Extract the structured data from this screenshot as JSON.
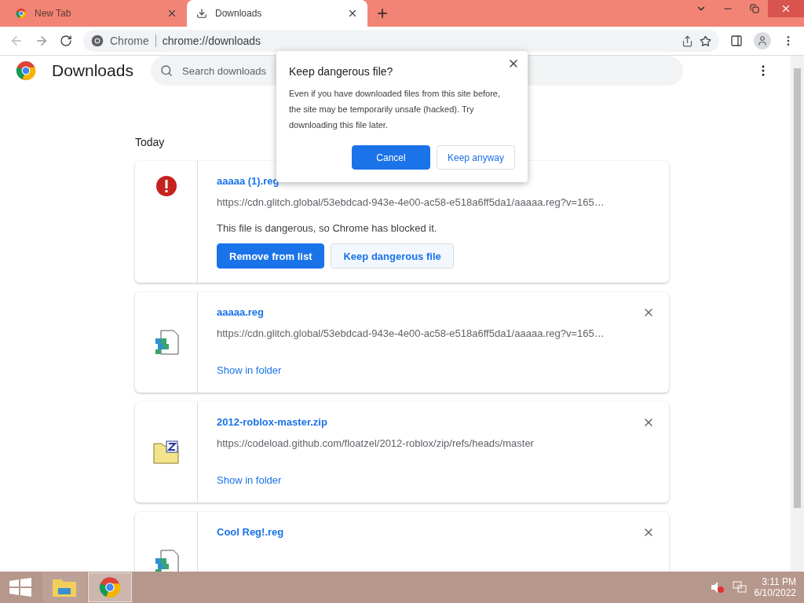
{
  "tabs": [
    {
      "title": "New Tab",
      "selected": false
    },
    {
      "title": "Downloads",
      "selected": true
    }
  ],
  "address": {
    "site_label": "Chrome",
    "url": "chrome://downloads"
  },
  "page": {
    "title": "Downloads",
    "search": {
      "placeholder": "Search downloads"
    },
    "section": "Today"
  },
  "downloads": [
    {
      "kind": "dangerous",
      "name": "aaaaa (1).reg",
      "url": "https://cdn.glitch.global/53ebdcad-943e-4e00-ac58-e518a6ff5da1/aaaaa.reg?v=165…",
      "warning": "This file is dangerous, so Chrome has blocked it.",
      "actions": [
        {
          "label": "Remove from list",
          "primary": true
        },
        {
          "label": "Keep dangerous file",
          "primary": false
        }
      ]
    },
    {
      "kind": "registry",
      "name": "aaaaa.reg",
      "url": "https://cdn.glitch.global/53ebdcad-943e-4e00-ac58-e518a6ff5da1/aaaaa.reg?v=165…",
      "link": "Show in folder"
    },
    {
      "kind": "zip",
      "name": "2012-roblox-master.zip",
      "url": "https://codeload.github.com/floatzel/2012-roblox/zip/refs/heads/master",
      "link": "Show in folder"
    },
    {
      "kind": "registry",
      "name": "Cool Reg!.reg"
    }
  ],
  "dialog": {
    "title": "Keep dangerous file?",
    "body": "Even if you have downloaded files from this site before, the site may be temporarily unsafe (hacked). Try downloading this file later.",
    "buttons": [
      {
        "label": "Cancel",
        "primary": true
      },
      {
        "label": "Keep anyway",
        "primary": false
      }
    ]
  },
  "taskbar": {
    "apps": [
      {
        "kind": "explorer",
        "selected": false
      },
      {
        "kind": "chrome",
        "selected": true
      }
    ],
    "time": "3:11 PM",
    "date": "6/10/2022"
  }
}
